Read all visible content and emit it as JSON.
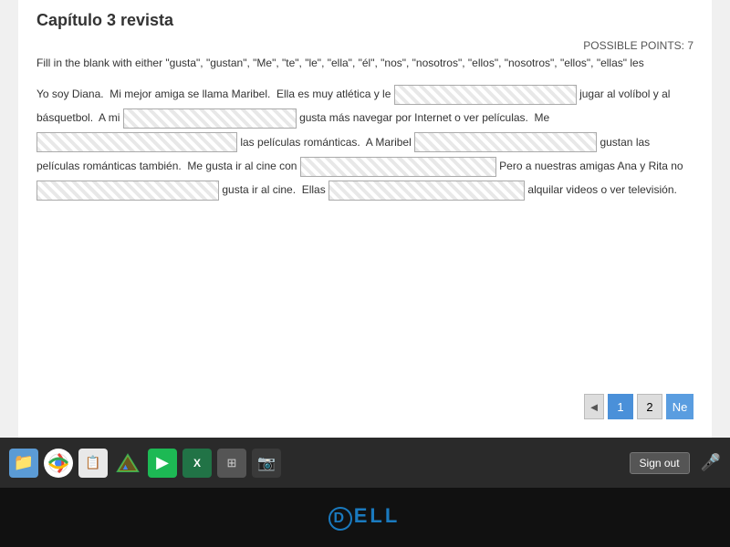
{
  "page": {
    "title": "Capítulo 3 revista",
    "possible_points_label": "POSSIBLE POINTS: 7",
    "instructions": "Fill in the blank with either \"gusta\", \"gustan\", \"Me\", \"te\", \"le\", \"ella\", \"él\", \"nos\", \"nosotros\", \"ellos\", \"nosotros\", \"ellos\", \"ellas\" les",
    "exercise_text_parts": [
      "Yo soy Diana.  Mi mejor amiga se llama Maribel.  Ella es muy atlética y le",
      "jugar al volíbol y al básquetbol.  A mi",
      "gusta más navegar por Internet o ver películas.  Me",
      "las películas románticas.  A Maribel",
      "gustan las películas románticas también.  Me gusta ir al cine con",
      "Pero a nuestras amigas Ana y Rita no",
      "gusta ir al cine.  Ellas",
      "alquilar videos o ver televisión."
    ]
  },
  "pagination": {
    "prev_arrow": "◄",
    "page_1": "1",
    "page_2": "2",
    "next_label": "Ne"
  },
  "taskbar": {
    "sign_out_label": "Sign out"
  },
  "dell": {
    "logo": "DELL"
  }
}
